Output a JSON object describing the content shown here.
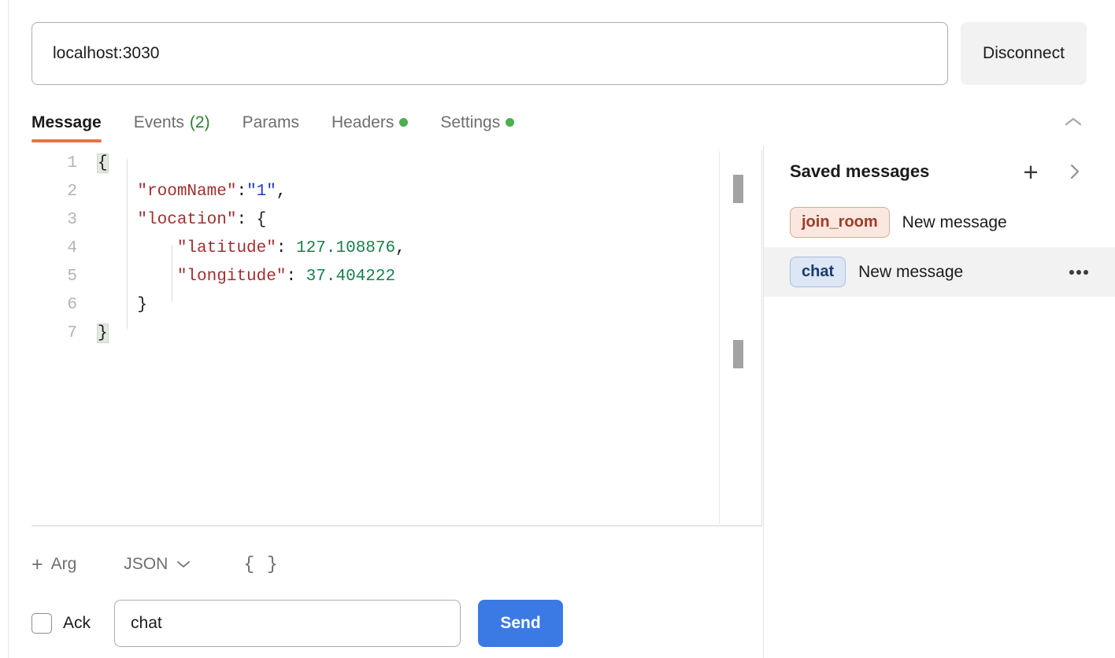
{
  "accent_color": "#ed7047",
  "connection": {
    "url_value": "localhost:3030",
    "url_placeholder": "Enter URL",
    "action_label": "Disconnect"
  },
  "tabs": [
    {
      "label": "Message",
      "active": true,
      "count": null,
      "dot": false
    },
    {
      "label": "Events",
      "active": false,
      "count": "(2)",
      "dot": false
    },
    {
      "label": "Params",
      "active": false,
      "count": null,
      "dot": false
    },
    {
      "label": "Headers",
      "active": false,
      "count": null,
      "dot": true
    },
    {
      "label": "Settings",
      "active": false,
      "count": null,
      "dot": true
    }
  ],
  "tabs_collapse_icon": "chevron-up-icon",
  "editor": {
    "language": "JSON",
    "lines": [
      {
        "n": "1",
        "segments": [
          {
            "t": "{",
            "cls": "k-punct brace-hl"
          }
        ]
      },
      {
        "n": "2",
        "segments": [
          {
            "t": "    ",
            "cls": "k-punct"
          },
          {
            "t": "\"roomName\"",
            "cls": "k-key"
          },
          {
            "t": ":",
            "cls": "k-punct"
          },
          {
            "t": "\"1\"",
            "cls": "k-str"
          },
          {
            "t": ",",
            "cls": "k-punct"
          }
        ]
      },
      {
        "n": "3",
        "segments": [
          {
            "t": "    ",
            "cls": "k-punct"
          },
          {
            "t": "\"location\"",
            "cls": "k-key"
          },
          {
            "t": ": {",
            "cls": "k-punct"
          }
        ]
      },
      {
        "n": "4",
        "segments": [
          {
            "t": "        ",
            "cls": "k-punct"
          },
          {
            "t": "\"latitude\"",
            "cls": "k-key"
          },
          {
            "t": ": ",
            "cls": "k-punct"
          },
          {
            "t": "127.108876",
            "cls": "k-num"
          },
          {
            "t": ",",
            "cls": "k-punct"
          }
        ]
      },
      {
        "n": "5",
        "segments": [
          {
            "t": "        ",
            "cls": "k-punct"
          },
          {
            "t": "\"longitude\"",
            "cls": "k-key"
          },
          {
            "t": ": ",
            "cls": "k-punct"
          },
          {
            "t": "37.404222",
            "cls": "k-num"
          }
        ]
      },
      {
        "n": "6",
        "segments": [
          {
            "t": "    }",
            "cls": "k-punct"
          }
        ]
      },
      {
        "n": "7",
        "segments": [
          {
            "t": "}",
            "cls": "k-punct brace-hl"
          }
        ]
      }
    ],
    "payload": {
      "roomName": "1",
      "location": {
        "latitude": 127.108876,
        "longitude": 37.404222
      }
    }
  },
  "arg_toolbar": {
    "add_label": "Arg",
    "add_icon": "plus-icon",
    "type_label": "JSON",
    "type_chevron": "chevron-down-icon",
    "format_label": "{ }"
  },
  "send_row": {
    "ack_label": "Ack",
    "ack_checked": false,
    "event_value": "chat",
    "event_placeholder": "Event name",
    "send_label": "Send"
  },
  "saved_messages": {
    "title": "Saved messages",
    "add_icon": "plus-icon",
    "expand_icon": "chevron-right-icon",
    "items": [
      {
        "event": "join_room",
        "name": "New message",
        "selected": false,
        "badge_class": "ev-join",
        "show_menu": false
      },
      {
        "event": "chat",
        "name": "New message",
        "selected": true,
        "badge_class": "ev-chat",
        "show_menu": true
      }
    ]
  }
}
